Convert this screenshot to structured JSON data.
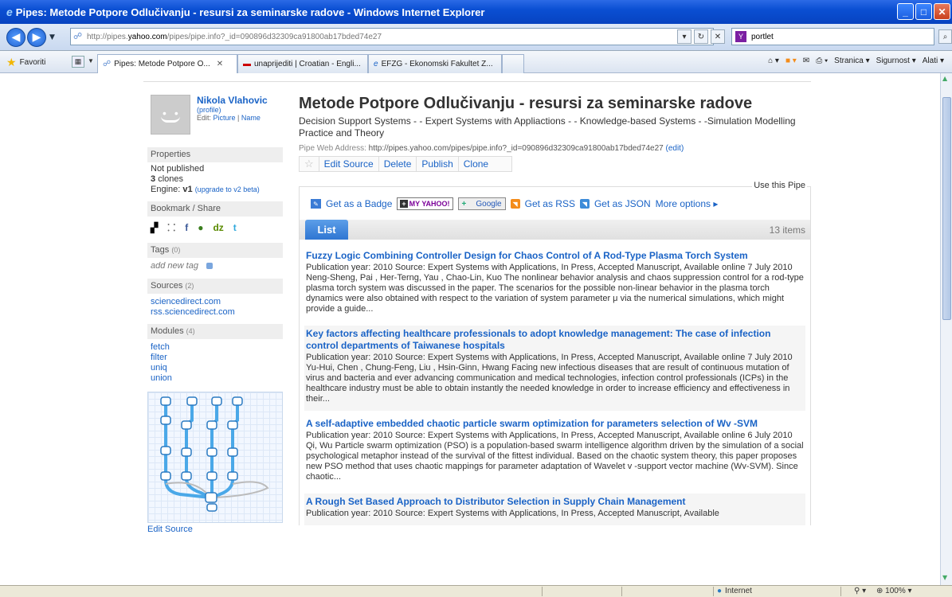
{
  "window": {
    "title": "Pipes: Metode Potpore Odlučivanju - resursi za seminarske radove - Windows Internet Explorer"
  },
  "address": {
    "url_prefix": "http://pipes.",
    "url_domain": "yahoo.com",
    "url_path": "/pipes/pipe.info?_id=090896d32309ca91800ab17bded74e27",
    "search_value": "portlet"
  },
  "tabs": {
    "favorites_label": "Favoriti",
    "items": [
      {
        "label": "Pipes: Metode Potpore O..."
      },
      {
        "label": "unaprijediti | Croatian - Engli..."
      },
      {
        "label": "EFZG - Ekonomski Fakultet Z..."
      }
    ],
    "menu": {
      "page": "Stranica",
      "safety": "Sigurnost",
      "tools": "Alati"
    }
  },
  "status": {
    "zone": "Internet",
    "zoom": "100%"
  },
  "sidebar": {
    "user_name": "Nikola Vlahovic",
    "profile_link": "(profile)",
    "edit_prefix": "Edit:",
    "edit_picture": "Picture",
    "edit_name": "Name",
    "properties_head": "Properties",
    "published_status": "Not published",
    "clones_count": "3",
    "clones_label": "clones",
    "engine_label": "Engine:",
    "engine_version": "v1",
    "upgrade_link": "(upgrade to v2 beta)",
    "bookmark_head": "Bookmark / Share",
    "tags_head": "Tags",
    "tags_count": "(0)",
    "add_tag": "add new tag",
    "sources_head": "Sources",
    "sources_count": "(2)",
    "sources": [
      "sciencedirect.com",
      "rss.sciencedirect.com"
    ],
    "modules_head": "Modules",
    "modules_count": "(4)",
    "modules": [
      "fetch",
      "filter",
      "uniq",
      "union"
    ],
    "edit_source": "Edit Source"
  },
  "main": {
    "title": "Metode Potpore Odlučivanju - resursi za seminarske radove",
    "description": "Decision Support Systems - - Expert Systems with Appliactions - - Knowledge-based Systems - -Simulation Modelling Practice and Theory",
    "web_address_label": "Pipe Web Address:",
    "web_address": "http://pipes.yahoo.com/pipes/pipe.info?_id=090896d32309ca91800ab17bded74e27",
    "edit_link": "(edit)",
    "actions": {
      "edit_source": "Edit Source",
      "delete": "Delete",
      "publish": "Publish",
      "clone": "Clone"
    },
    "use_pipe_label": "Use this Pipe",
    "get_badge": "Get as a Badge",
    "myyahoo": "MY YAHOO!",
    "google": "Google",
    "get_rss": "Get as RSS",
    "get_json": "Get as JSON",
    "more_options": "More options",
    "list_tab": "List",
    "item_count": "13 items",
    "items": [
      {
        "title": "Fuzzy Logic Combining Controller Design for Chaos Control of A Rod-Type Plasma Torch System",
        "body": "Publication year: 2010 Source: Expert Systems with Applications, In Press, Accepted Manuscript, Available online 7 July 2010 Neng-Sheng, Pai , Her-Terng, Yau , Chao-Lin, Kuo The nonlinear behavior analysis and chaos suppression control for a rod-type plasma torch system was discussed in the paper. The scenarios for the possible non-linear behavior in the plasma torch dynamics were also obtained with respect to the variation of system parameter μ via the numerical simulations, which might provide a guide..."
      },
      {
        "title": "Key factors affecting healthcare professionals to adopt knowledge management: The case of infection control departments of Taiwanese hospitals",
        "body": "Publication year: 2010 Source: Expert Systems with Applications, In Press, Accepted Manuscript, Available online 7 July 2010 Yu-Hui, Chen , Chung-Feng, Liu , Hsin-Ginn, Hwang Facing new infectious diseases that are result of continuous mutation of virus and bacteria and ever advancing communication and medical technologies, infection control professionals (ICPs) in the healthcare industry must be able to obtain instantly the needed knowledge in order to increase efficiency and effectiveness in their..."
      },
      {
        "title": "A self-adaptive embedded chaotic particle swarm optimization for parameters selection of Wv -SVM",
        "body": "Publication year: 2010 Source: Expert Systems with Applications, In Press, Accepted Manuscript, Available online 6 July 2010 Qi, Wu Particle swarm optimization (PSO) is a population-based swarm intelligence algorithm driven by the simulation of a social psychological metaphor instead of the survival of the fittest individual. Based on the chaotic system theory, this paper proposes new PSO method that uses chaotic mappings for parameter adaptation of Wavelet v -support vector machine (Wv-SVM). Since chaotic..."
      },
      {
        "title": "A Rough Set Based Approach to Distributor Selection in Supply Chain Management",
        "body": "Publication year: 2010 Source: Expert Systems with Applications, In Press, Accepted Manuscript, Available"
      }
    ]
  }
}
